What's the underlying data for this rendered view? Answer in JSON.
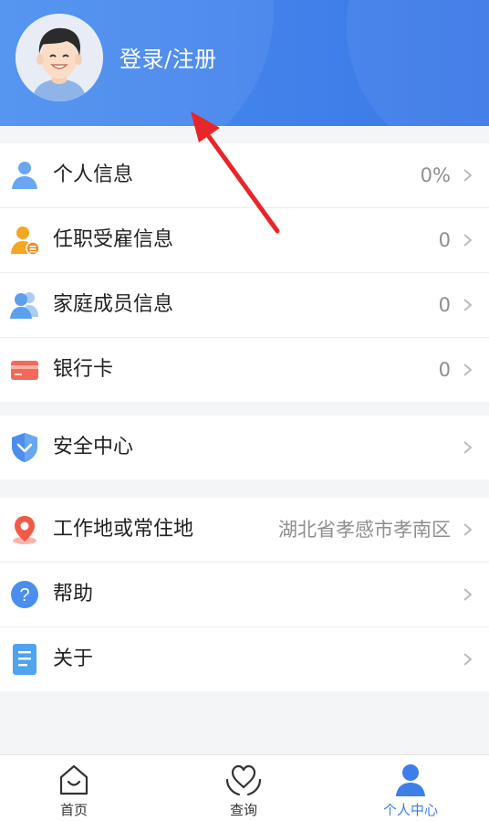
{
  "header": {
    "login_label": "登录/注册"
  },
  "menu_group_1": [
    {
      "label": "个人信息",
      "value": "0%"
    },
    {
      "label": "任职受雇信息",
      "value": "0"
    },
    {
      "label": "家庭成员信息",
      "value": "0"
    },
    {
      "label": "银行卡",
      "value": "0"
    }
  ],
  "menu_group_2": [
    {
      "label": "安全中心",
      "value": ""
    }
  ],
  "menu_group_3": [
    {
      "label": "工作地或常住地",
      "value": "湖北省孝感市孝南区"
    },
    {
      "label": "帮助",
      "value": ""
    },
    {
      "label": "关于",
      "value": ""
    }
  ],
  "tabbar": {
    "items": [
      {
        "label": "首页",
        "icon": "home-icon"
      },
      {
        "label": "查询",
        "icon": "heart-hands-icon"
      },
      {
        "label": "个人中心",
        "icon": "person-icon",
        "active": true
      }
    ]
  },
  "colors": {
    "accent": "#3d7fe8",
    "header_start": "#4a8ef0",
    "header_end": "#3a78e6",
    "annotation_arrow": "#e8252a"
  }
}
